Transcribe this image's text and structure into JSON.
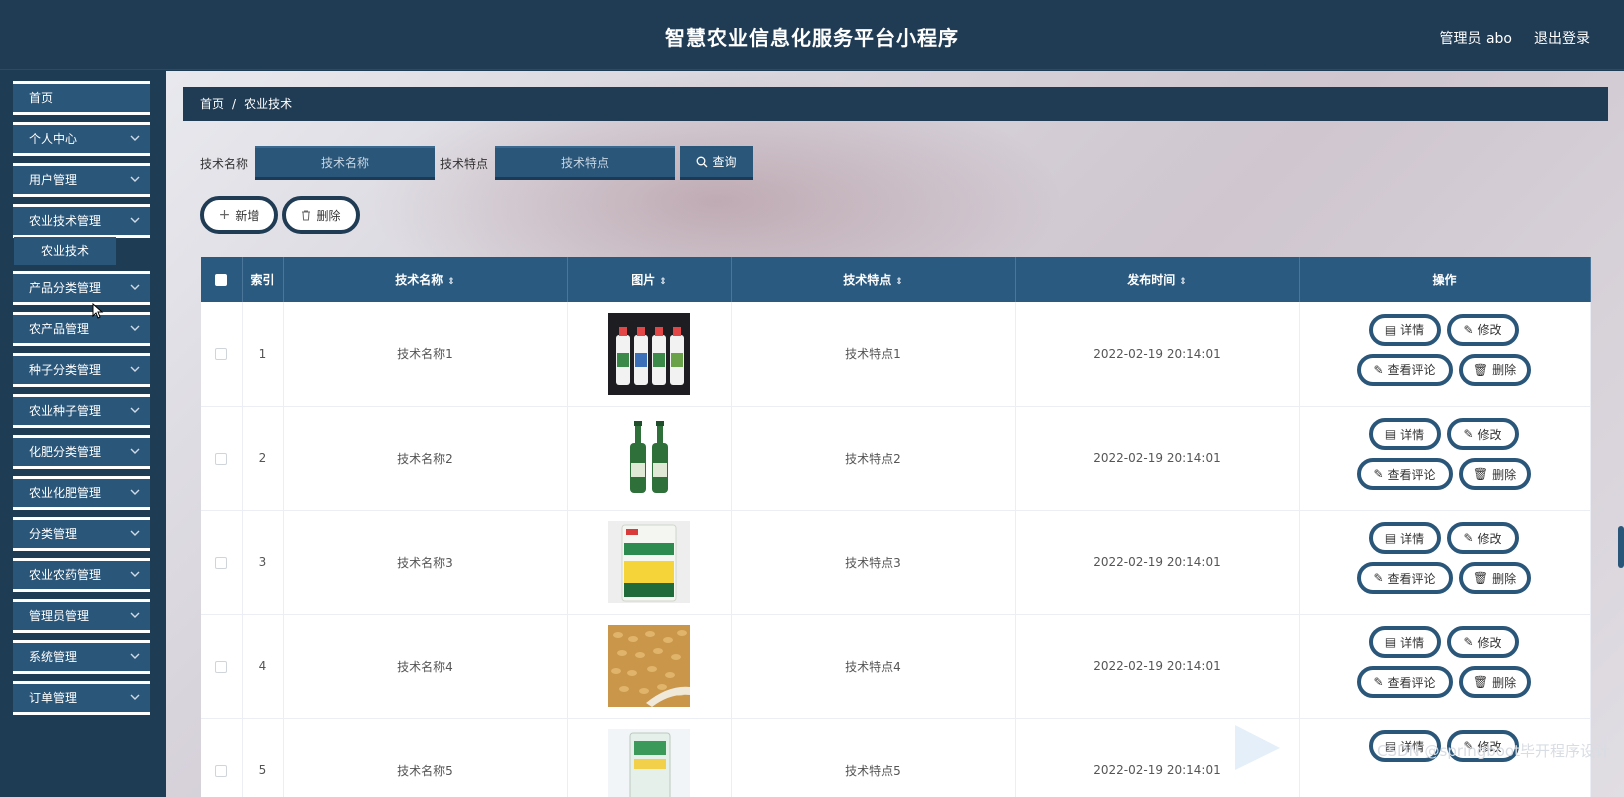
{
  "header": {
    "title": "智慧农业信息化服务平台小程序",
    "user": "管理员 abo",
    "logout": "退出登录"
  },
  "sidebar": {
    "items": [
      {
        "label": "首页",
        "has_arrow": false
      },
      {
        "label": "个人中心",
        "has_arrow": true
      },
      {
        "label": "用户管理",
        "has_arrow": true
      },
      {
        "label": "农业技术管理",
        "has_arrow": true
      },
      {
        "label": "产品分类管理",
        "has_arrow": true
      },
      {
        "label": "农产品管理",
        "has_arrow": true
      },
      {
        "label": "种子分类管理",
        "has_arrow": true
      },
      {
        "label": "农业种子管理",
        "has_arrow": true
      },
      {
        "label": "化肥分类管理",
        "has_arrow": true
      },
      {
        "label": "农业化肥管理",
        "has_arrow": true
      },
      {
        "label": "分类管理",
        "has_arrow": true
      },
      {
        "label": "农业农药管理",
        "has_arrow": true
      },
      {
        "label": "管理员管理",
        "has_arrow": true
      },
      {
        "label": "系统管理",
        "has_arrow": true
      },
      {
        "label": "订单管理",
        "has_arrow": true
      }
    ],
    "submenu": {
      "label": "农业技术"
    }
  },
  "breadcrumb": {
    "home": "首页",
    "separator": "/",
    "current": "农业技术"
  },
  "search": {
    "name_label": "技术名称",
    "name_placeholder": "技术名称",
    "feature_label": "技术特点",
    "feature_placeholder": "技术特点",
    "query_label": "查询"
  },
  "actions": {
    "add": "新增",
    "delete": "删除"
  },
  "table": {
    "headers": {
      "index": "索引",
      "name": "技术名称",
      "image": "图片",
      "feature": "技术特点",
      "time": "发布时间",
      "ops": "操作"
    },
    "rows": [
      {
        "index": "1",
        "name": "技术名称1",
        "image": "bottles-four",
        "feature": "技术特点1",
        "time": "2022-02-19 20:14:01"
      },
      {
        "index": "2",
        "name": "技术名称2",
        "image": "bottles-two-green",
        "feature": "技术特点2",
        "time": "2022-02-19 20:14:01"
      },
      {
        "index": "3",
        "name": "技术名称3",
        "image": "fertilizer-bag",
        "feature": "技术特点3",
        "time": "2022-02-19 20:14:01"
      },
      {
        "index": "4",
        "name": "技术名称4",
        "image": "wheat-grain",
        "feature": "技术特点4",
        "time": "2022-02-19 20:14:01"
      },
      {
        "index": "5",
        "name": "技术名称5",
        "image": "seed-bag",
        "feature": "技术特点5",
        "time": "2022-02-19 20:14:01"
      }
    ],
    "op_labels": {
      "detail": "详情",
      "edit": "修改",
      "comments": "查看评论",
      "delete": "删除"
    }
  },
  "watermark": "CSDN @springboot毕开程序设计",
  "colors": {
    "primary": "#2a5679",
    "header": "#203c54"
  }
}
